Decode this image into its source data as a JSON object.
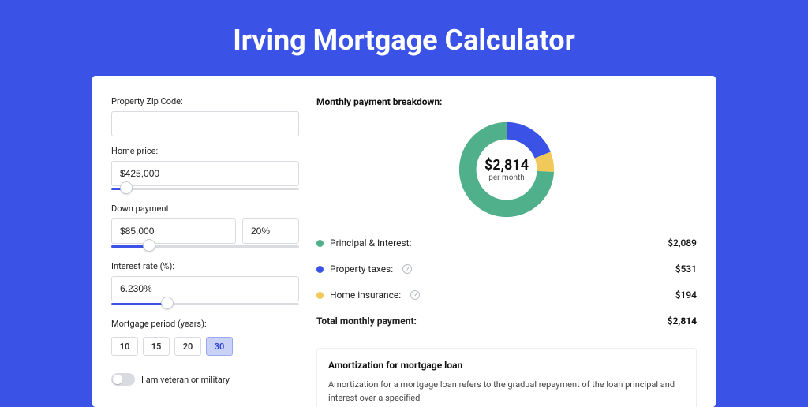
{
  "page": {
    "title": "Irving Mortgage Calculator"
  },
  "form": {
    "zip": {
      "label": "Property Zip Code:",
      "value": ""
    },
    "price": {
      "label": "Home price:",
      "value": "$425,000",
      "slider_percent": 8
    },
    "down": {
      "label": "Down payment:",
      "value": "$85,000",
      "percent": "20%",
      "slider_percent": 20
    },
    "rate": {
      "label": "Interest rate (%):",
      "value": "6.230%",
      "slider_percent": 30
    },
    "period": {
      "label": "Mortgage period (years):",
      "options": [
        "10",
        "15",
        "20",
        "30"
      ],
      "active_index": 3
    },
    "veteran": {
      "label": "I am veteran or military",
      "on": false
    }
  },
  "breakdown": {
    "title": "Monthly payment breakdown:",
    "center_amount": "$2,814",
    "center_sub": "per month",
    "items": [
      {
        "label": "Principal & Interest:",
        "value": "$2,089",
        "color": "#4fb08b",
        "info": false
      },
      {
        "label": "Property taxes:",
        "value": "$531",
        "color": "#3a53e6",
        "info": true
      },
      {
        "label": "Home insurance:",
        "value": "$194",
        "color": "#f0c95a",
        "info": true
      }
    ],
    "total": {
      "label": "Total monthly payment:",
      "value": "$2,814"
    }
  },
  "chart_data": {
    "type": "pie",
    "title": "Monthly payment breakdown",
    "series": [
      {
        "name": "Principal & Interest",
        "value": 2089,
        "color": "#4fb08b"
      },
      {
        "name": "Property taxes",
        "value": 531,
        "color": "#3a53e6"
      },
      {
        "name": "Home insurance",
        "value": 194,
        "color": "#f0c95a"
      }
    ],
    "total": 2814,
    "center_label": "$2,814",
    "center_sub": "per month"
  },
  "amortization": {
    "title": "Amortization for mortgage loan",
    "text": "Amortization for a mortgage loan refers to the gradual repayment of the loan principal and interest over a specified"
  }
}
